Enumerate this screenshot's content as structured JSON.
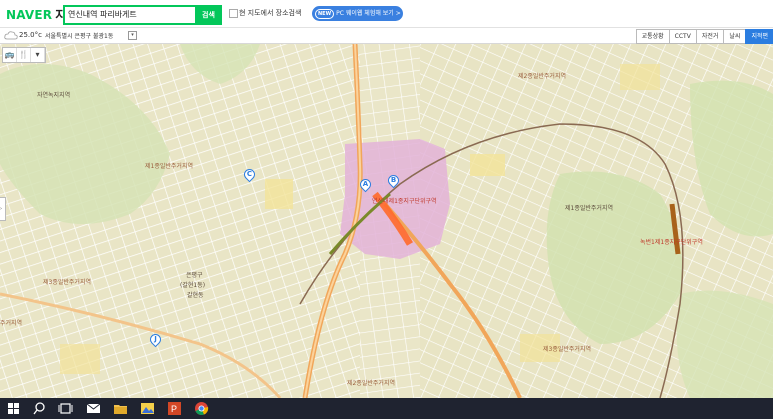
{
  "header": {
    "logo_brand": "NAVER",
    "logo_title": "지도",
    "search_value": "연신내역 파리바게트",
    "search_button": "검색",
    "checkbox_label": "현 지도에서 장소검색",
    "pc_badge": "NEW",
    "pc_link": "PC 웨이웹 체험해 보기 >"
  },
  "infobar": {
    "weather_icon": "cloud-icon",
    "temperature": "25.0°c",
    "location": "서울특별시 은평구 불광1동",
    "location_dropdown": "▾"
  },
  "layer_tabs": [
    {
      "label": "교통상황",
      "active": false
    },
    {
      "label": "CCTV",
      "active": false
    },
    {
      "label": "자전거",
      "active": false
    },
    {
      "label": "날씨",
      "active": false
    },
    {
      "label": "지적편",
      "active": true
    }
  ],
  "map": {
    "tool_buttons": [
      {
        "icon": "bus-icon",
        "glyph": "🚌"
      },
      {
        "icon": "restaurant-icon",
        "glyph": "🍴"
      },
      {
        "icon": "dropdown-icon",
        "glyph": "▾"
      }
    ],
    "side_handle": "›",
    "zones": [
      {
        "text": "제2종일반주거지역"
      },
      {
        "text": "자연녹지지역"
      },
      {
        "text": "제1종일반주거지역"
      },
      {
        "text": "연신내제1종지구단위구역"
      },
      {
        "text": "제1종일반주거지역"
      },
      {
        "text": "녹번1제1종지구단위구역"
      },
      {
        "text": "제3종일반주거지역"
      },
      {
        "text": "은평구"
      },
      {
        "text": "(갈현1동)"
      },
      {
        "text": "갈현동"
      },
      {
        "text": "주거지역"
      },
      {
        "text": "제3종일반주거지역"
      },
      {
        "text": "제2종일반주거지역"
      }
    ],
    "markers": [
      {
        "label": "A"
      },
      {
        "label": "B"
      },
      {
        "label": "C"
      },
      {
        "label": "J"
      }
    ]
  },
  "taskbar": {
    "icons": [
      "windows-start-icon",
      "search-icon",
      "task-view-icon",
      "mail-icon",
      "file-explorer-icon",
      "photos-icon",
      "powerpoint-icon",
      "chrome-icon"
    ]
  }
}
